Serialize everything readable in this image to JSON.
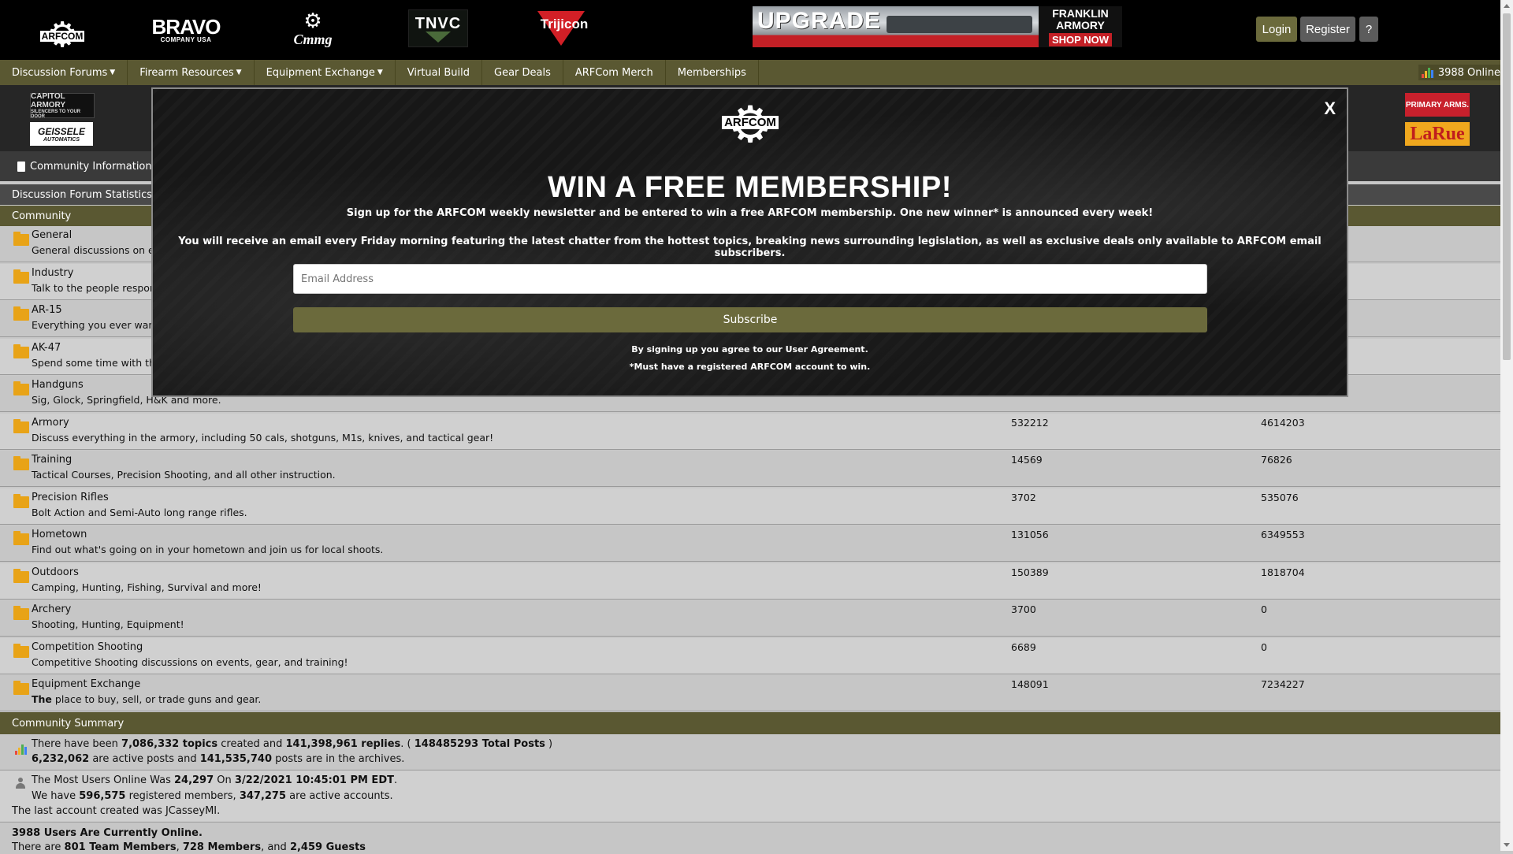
{
  "header": {
    "logos": {
      "arfcom": "ARFCOM",
      "bravo_big": "BRAVO",
      "bravo_small": "COMPANY USA",
      "cmmg": "Cmmg",
      "tnvc": "TNVC",
      "trijicon": "Trijicon"
    },
    "banner": {
      "headline": "UPGRADE",
      "brand": "FRANKLIN ARMORY",
      "cta": "SHOP NOW"
    },
    "login_label": "Login",
    "register_label": "Register",
    "help_label": "?"
  },
  "nav": {
    "items": [
      {
        "label": "Discussion Forums",
        "dropdown": true
      },
      {
        "label": "Firearm Resources",
        "dropdown": true
      },
      {
        "label": "Equipment Exchange",
        "dropdown": true
      },
      {
        "label": "Virtual Build",
        "dropdown": false
      },
      {
        "label": "Gear Deals",
        "dropdown": false
      },
      {
        "label": "ARFCom Merch",
        "dropdown": false
      },
      {
        "label": "Memberships",
        "dropdown": false
      }
    ],
    "online": "3988 Online"
  },
  "sponsors": {
    "capitol": "CAPITOL ARMORY",
    "capitol_tag": "SILENCERS TO YOUR DOOR",
    "geissele": "GEISSELE",
    "geissele_tag": "AUTOMATICS",
    "primary": "PRIMARY ARMS.",
    "larue": "LaRue"
  },
  "info_bar": "Community Information Ar",
  "stats_heading": "Discussion Forum Statistics",
  "community_heading": "Community",
  "forums": [
    {
      "name": "General",
      "desc": "General discussions on eve",
      "topics": "",
      "posts": ""
    },
    {
      "name": "Industry",
      "desc": "Talk to the people respons",
      "topics": "",
      "posts": ""
    },
    {
      "name": "AR-15",
      "desc": "Everything you ever wante",
      "topics": "",
      "posts": ""
    },
    {
      "name": "AK-47",
      "desc": "Spend some time with the",
      "topics": "",
      "posts": ""
    },
    {
      "name": "Handguns",
      "desc": "Sig, Glock, Springfield, H&K and more.",
      "topics": "",
      "posts": ""
    },
    {
      "name": "Armory",
      "desc": "Discuss everything in the armory, including 50 cals, shotguns, M1s, knives, and tactical gear!",
      "topics": "532212",
      "posts": "4614203"
    },
    {
      "name": "Training",
      "desc": "Tactical Courses, Precision Shooting, and all other instruction.",
      "topics": "14569",
      "posts": "76826"
    },
    {
      "name": "Precision Rifles",
      "desc": "Bolt Action and Semi-Auto long range rifles.",
      "topics": "3702",
      "posts": "535076"
    },
    {
      "name": "Hometown",
      "desc": "Find out what's going on in your hometown and join us for local shoots.",
      "topics": "131056",
      "posts": "6349553"
    },
    {
      "name": "Outdoors",
      "desc": "Camping, Hunting, Fishing, Survival and more!",
      "topics": "150389",
      "posts": "1818704"
    },
    {
      "name": "Archery",
      "desc": "Shooting, Hunting, Equipment!",
      "topics": "3700",
      "posts": "0"
    },
    {
      "name": "Competition Shooting",
      "desc": "Competitive Shooting discussions on events, gear, and training!",
      "topics": "6689",
      "posts": "0"
    },
    {
      "name": "Equipment Exchange",
      "desc_bold": "The",
      "desc": " place to buy, sell, or trade guns and gear.",
      "topics": "148091",
      "posts": "7234227"
    }
  ],
  "summary": {
    "heading": "Community Summary",
    "l1_a": "There have been ",
    "topics": "7,086,332 topics",
    "l1_b": " created and ",
    "replies": "141,398,961 replies",
    "l1_c": ". ( ",
    "total": "148485293 Total Posts",
    "l1_d": " )",
    "active_posts": "6,232,062",
    "l2_a": " are active posts and ",
    "archived_posts": "141,535,740",
    "l2_b": " posts are in the archives.",
    "most_a": "The Most Users Online Was ",
    "most_count": "24,297",
    "most_b": " On ",
    "most_date": "3/22/2021 10:45:01 PM EDT",
    "most_c": ".",
    "have_a": "We have ",
    "registered": "596,575",
    "have_b": " registered members, ",
    "active_accounts": "347,275",
    "have_c": " are active accounts.",
    "last_account": "The last account created was JCasseyMI.",
    "online_heading": "3988 Users Are Currently Online.",
    "there_a": "There are ",
    "team": "801 Team Members",
    "there_b": ", ",
    "members": "728 Members",
    "there_c": ", and ",
    "guests": "2,459 Guests"
  },
  "modal": {
    "logo_text": "ARFCOM",
    "close": "X",
    "title": "WIN A FREE MEMBERSHIP!",
    "subtitle": "Sign up for the ARFCOM weekly newsletter and be entered to win a free ARFCOM membership. One new winner* is announced every week!",
    "body": "You will receive an email every Friday morning featuring the latest chatter from the hottest topics, breaking news surrounding legislation, as well as exclusive deals only available to ARFCOM email subscribers.",
    "email_placeholder": "Email Address",
    "subscribe_label": "Subscribe",
    "agree_prefix": "By signing up you agree to our ",
    "agree_link": "User Agreement",
    "agree_suffix": ".",
    "footnote": "*Must have a registered ARFCOM account to win."
  },
  "colors": {
    "olive": "#5a5832",
    "button_olive": "#6b6a3c",
    "folder": "#e8a317"
  }
}
